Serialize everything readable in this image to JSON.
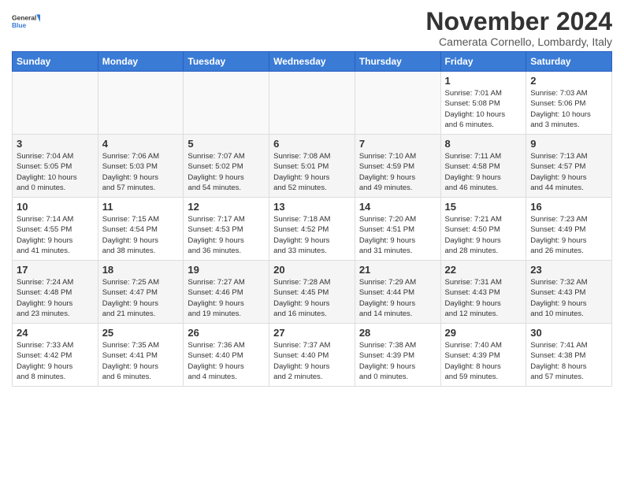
{
  "header": {
    "logo_general": "General",
    "logo_blue": "Blue",
    "month_title": "November 2024",
    "subtitle": "Camerata Cornello, Lombardy, Italy"
  },
  "weekdays": [
    "Sunday",
    "Monday",
    "Tuesday",
    "Wednesday",
    "Thursday",
    "Friday",
    "Saturday"
  ],
  "weeks": [
    [
      {
        "day": "",
        "info": ""
      },
      {
        "day": "",
        "info": ""
      },
      {
        "day": "",
        "info": ""
      },
      {
        "day": "",
        "info": ""
      },
      {
        "day": "",
        "info": ""
      },
      {
        "day": "1",
        "info": "Sunrise: 7:01 AM\nSunset: 5:08 PM\nDaylight: 10 hours\nand 6 minutes."
      },
      {
        "day": "2",
        "info": "Sunrise: 7:03 AM\nSunset: 5:06 PM\nDaylight: 10 hours\nand 3 minutes."
      }
    ],
    [
      {
        "day": "3",
        "info": "Sunrise: 7:04 AM\nSunset: 5:05 PM\nDaylight: 10 hours\nand 0 minutes."
      },
      {
        "day": "4",
        "info": "Sunrise: 7:06 AM\nSunset: 5:03 PM\nDaylight: 9 hours\nand 57 minutes."
      },
      {
        "day": "5",
        "info": "Sunrise: 7:07 AM\nSunset: 5:02 PM\nDaylight: 9 hours\nand 54 minutes."
      },
      {
        "day": "6",
        "info": "Sunrise: 7:08 AM\nSunset: 5:01 PM\nDaylight: 9 hours\nand 52 minutes."
      },
      {
        "day": "7",
        "info": "Sunrise: 7:10 AM\nSunset: 4:59 PM\nDaylight: 9 hours\nand 49 minutes."
      },
      {
        "day": "8",
        "info": "Sunrise: 7:11 AM\nSunset: 4:58 PM\nDaylight: 9 hours\nand 46 minutes."
      },
      {
        "day": "9",
        "info": "Sunrise: 7:13 AM\nSunset: 4:57 PM\nDaylight: 9 hours\nand 44 minutes."
      }
    ],
    [
      {
        "day": "10",
        "info": "Sunrise: 7:14 AM\nSunset: 4:55 PM\nDaylight: 9 hours\nand 41 minutes."
      },
      {
        "day": "11",
        "info": "Sunrise: 7:15 AM\nSunset: 4:54 PM\nDaylight: 9 hours\nand 38 minutes."
      },
      {
        "day": "12",
        "info": "Sunrise: 7:17 AM\nSunset: 4:53 PM\nDaylight: 9 hours\nand 36 minutes."
      },
      {
        "day": "13",
        "info": "Sunrise: 7:18 AM\nSunset: 4:52 PM\nDaylight: 9 hours\nand 33 minutes."
      },
      {
        "day": "14",
        "info": "Sunrise: 7:20 AM\nSunset: 4:51 PM\nDaylight: 9 hours\nand 31 minutes."
      },
      {
        "day": "15",
        "info": "Sunrise: 7:21 AM\nSunset: 4:50 PM\nDaylight: 9 hours\nand 28 minutes."
      },
      {
        "day": "16",
        "info": "Sunrise: 7:23 AM\nSunset: 4:49 PM\nDaylight: 9 hours\nand 26 minutes."
      }
    ],
    [
      {
        "day": "17",
        "info": "Sunrise: 7:24 AM\nSunset: 4:48 PM\nDaylight: 9 hours\nand 23 minutes."
      },
      {
        "day": "18",
        "info": "Sunrise: 7:25 AM\nSunset: 4:47 PM\nDaylight: 9 hours\nand 21 minutes."
      },
      {
        "day": "19",
        "info": "Sunrise: 7:27 AM\nSunset: 4:46 PM\nDaylight: 9 hours\nand 19 minutes."
      },
      {
        "day": "20",
        "info": "Sunrise: 7:28 AM\nSunset: 4:45 PM\nDaylight: 9 hours\nand 16 minutes."
      },
      {
        "day": "21",
        "info": "Sunrise: 7:29 AM\nSunset: 4:44 PM\nDaylight: 9 hours\nand 14 minutes."
      },
      {
        "day": "22",
        "info": "Sunrise: 7:31 AM\nSunset: 4:43 PM\nDaylight: 9 hours\nand 12 minutes."
      },
      {
        "day": "23",
        "info": "Sunrise: 7:32 AM\nSunset: 4:43 PM\nDaylight: 9 hours\nand 10 minutes."
      }
    ],
    [
      {
        "day": "24",
        "info": "Sunrise: 7:33 AM\nSunset: 4:42 PM\nDaylight: 9 hours\nand 8 minutes."
      },
      {
        "day": "25",
        "info": "Sunrise: 7:35 AM\nSunset: 4:41 PM\nDaylight: 9 hours\nand 6 minutes."
      },
      {
        "day": "26",
        "info": "Sunrise: 7:36 AM\nSunset: 4:40 PM\nDaylight: 9 hours\nand 4 minutes."
      },
      {
        "day": "27",
        "info": "Sunrise: 7:37 AM\nSunset: 4:40 PM\nDaylight: 9 hours\nand 2 minutes."
      },
      {
        "day": "28",
        "info": "Sunrise: 7:38 AM\nSunset: 4:39 PM\nDaylight: 9 hours\nand 0 minutes."
      },
      {
        "day": "29",
        "info": "Sunrise: 7:40 AM\nSunset: 4:39 PM\nDaylight: 8 hours\nand 59 minutes."
      },
      {
        "day": "30",
        "info": "Sunrise: 7:41 AM\nSunset: 4:38 PM\nDaylight: 8 hours\nand 57 minutes."
      }
    ]
  ]
}
